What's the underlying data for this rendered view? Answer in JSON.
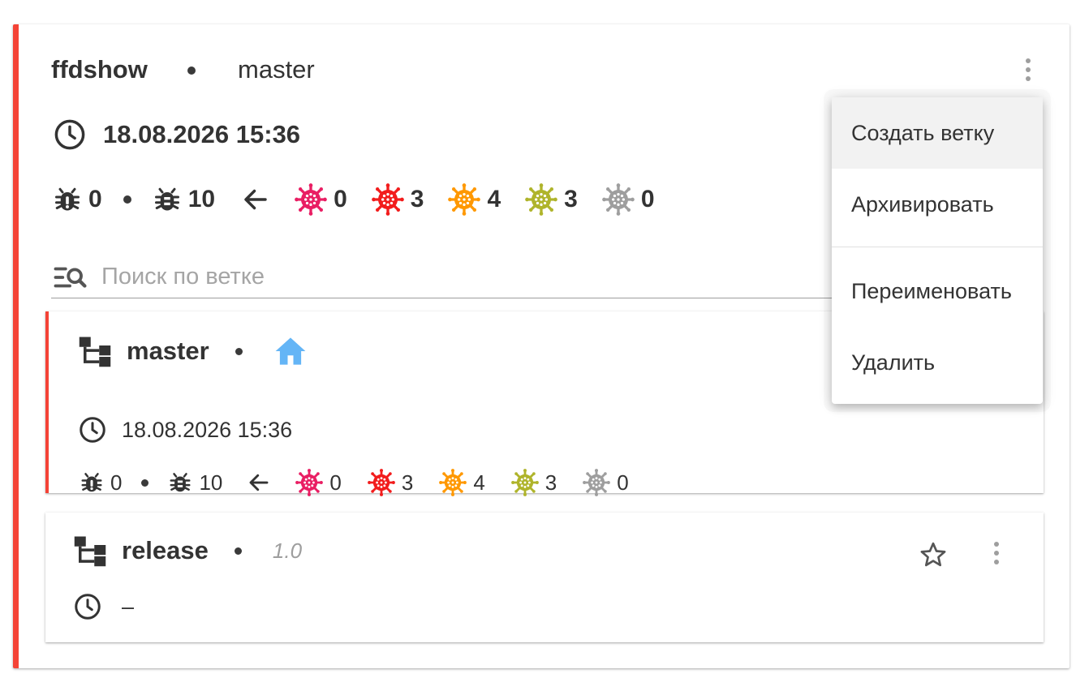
{
  "project": {
    "name": "ffdshow",
    "branch": "master",
    "date": "18.08.2026 15:36",
    "stats": {
      "bugs_new": "0",
      "bugs_total": "10",
      "critical": "0",
      "high": "3",
      "medium": "4",
      "low": "3",
      "info": "0"
    }
  },
  "search": {
    "placeholder": "Поиск по ветке"
  },
  "menu": {
    "items": [
      "Создать ветку",
      "Архивировать",
      "Переименовать",
      "Удалить"
    ]
  },
  "branches": [
    {
      "name": "master",
      "date": "18.08.2026 15:36",
      "stats": {
        "bugs_new": "0",
        "bugs_total": "10",
        "critical": "0",
        "high": "3",
        "medium": "4",
        "low": "3",
        "info": "0"
      }
    },
    {
      "name": "release",
      "version": "1.0",
      "date": "–"
    }
  ],
  "colors": {
    "accent_red": "#f44336",
    "critical": "#e91e63",
    "high": "#f21c1c",
    "medium": "#ff9800",
    "low": "#afb42b",
    "info": "#9e9e9e",
    "home": "#64b5f6"
  },
  "icons": {
    "clock": "clock-icon",
    "bug_outline": "bug-alert-icon",
    "bug": "bug-icon",
    "arrow_left": "arrow-left-icon",
    "virus": "virus-icon",
    "search": "text-search-icon",
    "branch": "branch-icon",
    "home": "home-icon",
    "star": "star-outline-icon",
    "more": "more-vert-icon"
  }
}
